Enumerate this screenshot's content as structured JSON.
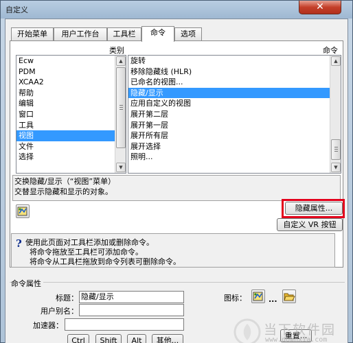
{
  "window": {
    "title": "自定义",
    "close_glyph": "✕"
  },
  "tabs": [
    "开始菜单",
    "用户工作台",
    "工具栏",
    "命令",
    "选项"
  ],
  "active_tab": "命令",
  "categories": {
    "header": "类别",
    "items": [
      "Ecw",
      "PDM",
      "XCAA2",
      "帮助",
      "编辑",
      "窗口",
      "工具",
      "视图",
      "文件",
      "选择"
    ],
    "selected": "视图"
  },
  "commands": {
    "header": "命令",
    "items": [
      "旋转",
      "移除隐藏线 (HLR)",
      "已命名的视图...",
      "隐藏/显示",
      "应用自定义的视图",
      "展开第二层",
      "展开第一层",
      "展开所有层",
      "展开选择",
      "照明..."
    ],
    "selected": "隐藏/显示"
  },
  "description": {
    "line1": "交换隐藏/显示（“视图”菜单）",
    "line2": "交替显示隐藏和显示的对象。"
  },
  "buttons": {
    "hide_props": "隐藏属性...",
    "custom_vr": "自定义 VR 按钮",
    "reset": "重置..."
  },
  "hint": {
    "line1": "使用此页面对工具栏添加或删除命令。",
    "line2": "将命令拖放至工具栏可添加命令。",
    "line3": "将命令从工具栏拖放到命令列表可删除命令。"
  },
  "props": {
    "section_label": "命令属性",
    "title_label": "标题：",
    "title_value": "隐藏/显示",
    "alias_label": "用户别名：",
    "alias_value": "",
    "accel_label": "加速器：",
    "accel_value": "",
    "icon_label": "图标：",
    "ellipsis": "...",
    "ctrl": "Ctrl",
    "shift": "Shift",
    "alt": "Alt",
    "other": "其他..."
  },
  "watermark": {
    "cn": "当下软件园",
    "url": "www.downxia.com"
  },
  "colors": {
    "selection": "#3399ff",
    "highlight_frame": "#e3001b",
    "close_button": "#c4402a"
  }
}
